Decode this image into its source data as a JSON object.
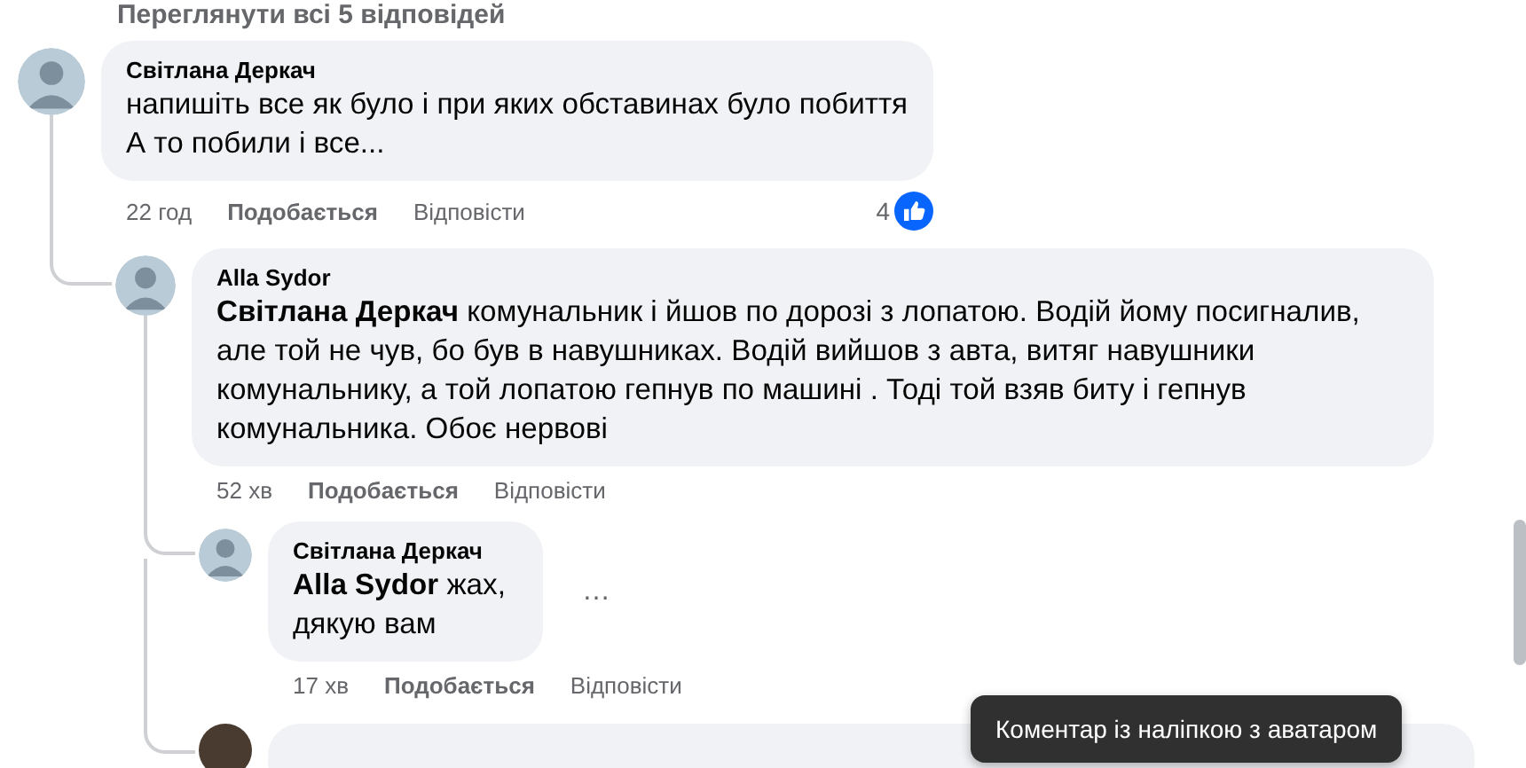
{
  "view_replies_link": "Переглянути всі 5 відповідей",
  "comments": [
    {
      "kind": "comment",
      "author": "Світлана Деркач",
      "text": "напишіть все як було і при яких обставинах було побиття\nА то побили і все...",
      "time": "22 год",
      "like_label": "Подобається",
      "reply_label": "Відповісти",
      "reaction_count": "4",
      "children": [
        {
          "kind": "comment",
          "author": "Alla Sydor",
          "text": "**Світлана Деркач** комунальник і йшов по дорозі з лопатою. Водій йому посигналив, але той не чув, бо був в навушниках. Водій вийшов з авта, витяг навушники комунальнику, а той лопатою гепнув по машині . Тоді той взяв биту і гепнув комунальника. Обоє нервові",
          "time": "52 хв",
          "like_label": "Подобається",
          "reply_label": "Відповісти",
          "children": [
            {
              "kind": "comment",
              "author": "Світлана Деркач",
              "text": "**Alla Sydor** жах, дякую вам",
              "time": "17 хв",
              "like_label": "Подобається",
              "reply_label": "Відповісти",
              "more_button": "…"
            },
            {
              "kind": "cut_off"
            }
          ]
        }
      ]
    }
  ],
  "tooltip": "Коментар із наліпкою з аватаром"
}
